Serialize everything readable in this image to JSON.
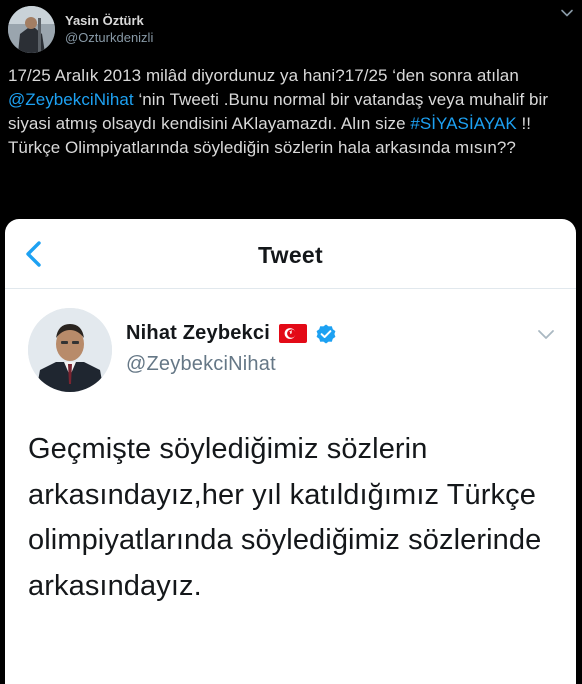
{
  "outer_tweet": {
    "author_name": "Yasin Öztürk",
    "author_handle": "@Ozturkdenizli",
    "text_parts": [
      {
        "type": "text",
        "value": "17/25 Aralık 2013 milâd diyordunuz ya hani?17/25 ‘den sonra atılan  "
      },
      {
        "type": "mention",
        "value": "@ZeybekciNihat"
      },
      {
        "type": "text",
        "value": " ‘nin Tweeti .Bunu normal bir vatandaş veya muhalif bir siyasi atmış olsaydı kendisini AKlayamazdı. Alın size "
      },
      {
        "type": "hashtag",
        "value": "#SİYASİAYAK"
      },
      {
        "type": "text",
        "value": "  !!       Türkçe Olimpiyatlarında söylediğin sözlerin hala arkasında mısın??"
      }
    ]
  },
  "embedded_screenshot": {
    "title": "Tweet",
    "author_name": "Nihat Zeybekci",
    "author_handle": "@ZeybekciNihat",
    "tweet_text": "Geçmişte söylediğimiz sözlerin arkasındayız,her yıl katıldığımız Türkçe olimpiyatlarında söylediğimiz sözlerinde arkasındayız."
  },
  "colors": {
    "background": "#000000",
    "text": "#d9d9d9",
    "link": "#1da1f2",
    "handle": "#8899a6",
    "verified": "#1da1f2",
    "flag": "#e30a17"
  },
  "icons": {
    "outer_chevron": "chevron-down-icon",
    "back": "chevron-left-icon",
    "flag": "turkey-flag-icon",
    "verified": "verified-badge-icon",
    "inner_chevron": "chevron-down-icon"
  }
}
